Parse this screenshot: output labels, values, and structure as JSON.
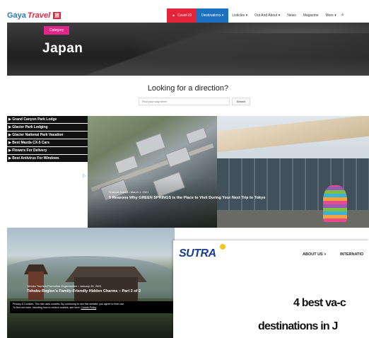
{
  "header": {
    "logo_gaya": "Gaya",
    "logo_travel": "Travel",
    "logo_badge": "旅",
    "nav": {
      "covid": "Covid-19",
      "destinations": "Destinations ▾",
      "listicles": "Listicles ▾",
      "out_and_about": "Out And About ▾",
      "news": "News",
      "magazine": "Magazine",
      "more": "More ▾"
    }
  },
  "hero": {
    "category": "Category",
    "title": "Japan"
  },
  "search": {
    "heading": "Looking for a direction?",
    "placeholder": "Find your way here!",
    "button": "Search"
  },
  "ads": {
    "items": [
      "▶ Grand Canyon Park Lodge",
      "▶ Glacier Park Lodging",
      "▶ Glacier National Park Vacation",
      "▶ Best Mazda CX-5 Cars",
      "▶ Flowers For Delivery",
      "▶ Best Antivirus For Windows"
    ],
    "corner": "▷"
  },
  "posts": [
    {
      "meta": "Shahida Sakeri • March 1, 2021",
      "title": "5 Reasons Why GREEN SPRINGS is the Place to Visit During Your Next Trip to Tokyo"
    },
    {
      "meta": "Tohoku Tourism Promotion Organization • January 26, 2021",
      "title": "Tohoku Region's Family-Friendly Hidden Charms – Part 2 of 2"
    }
  ],
  "cookie": {
    "line1": "Privacy & Cookies: This site uses cookies. By continuing to use this website, you agree to their use.",
    "line2": "To find out more, including how to control cookies, see here:",
    "link": "Cookie Policy"
  },
  "sutra": {
    "logo": "SUTRA",
    "nav_about": "ABOUT US ˅",
    "nav_international": "INTERNATIO",
    "headline_line1": "4 best va-c",
    "headline_line2": "destinations in J"
  },
  "colors": {
    "brand_red": "#e3243b",
    "brand_blue": "#1d6fc0",
    "category_pink": "#e3248b",
    "sutra_blue": "#1a3c8f"
  }
}
